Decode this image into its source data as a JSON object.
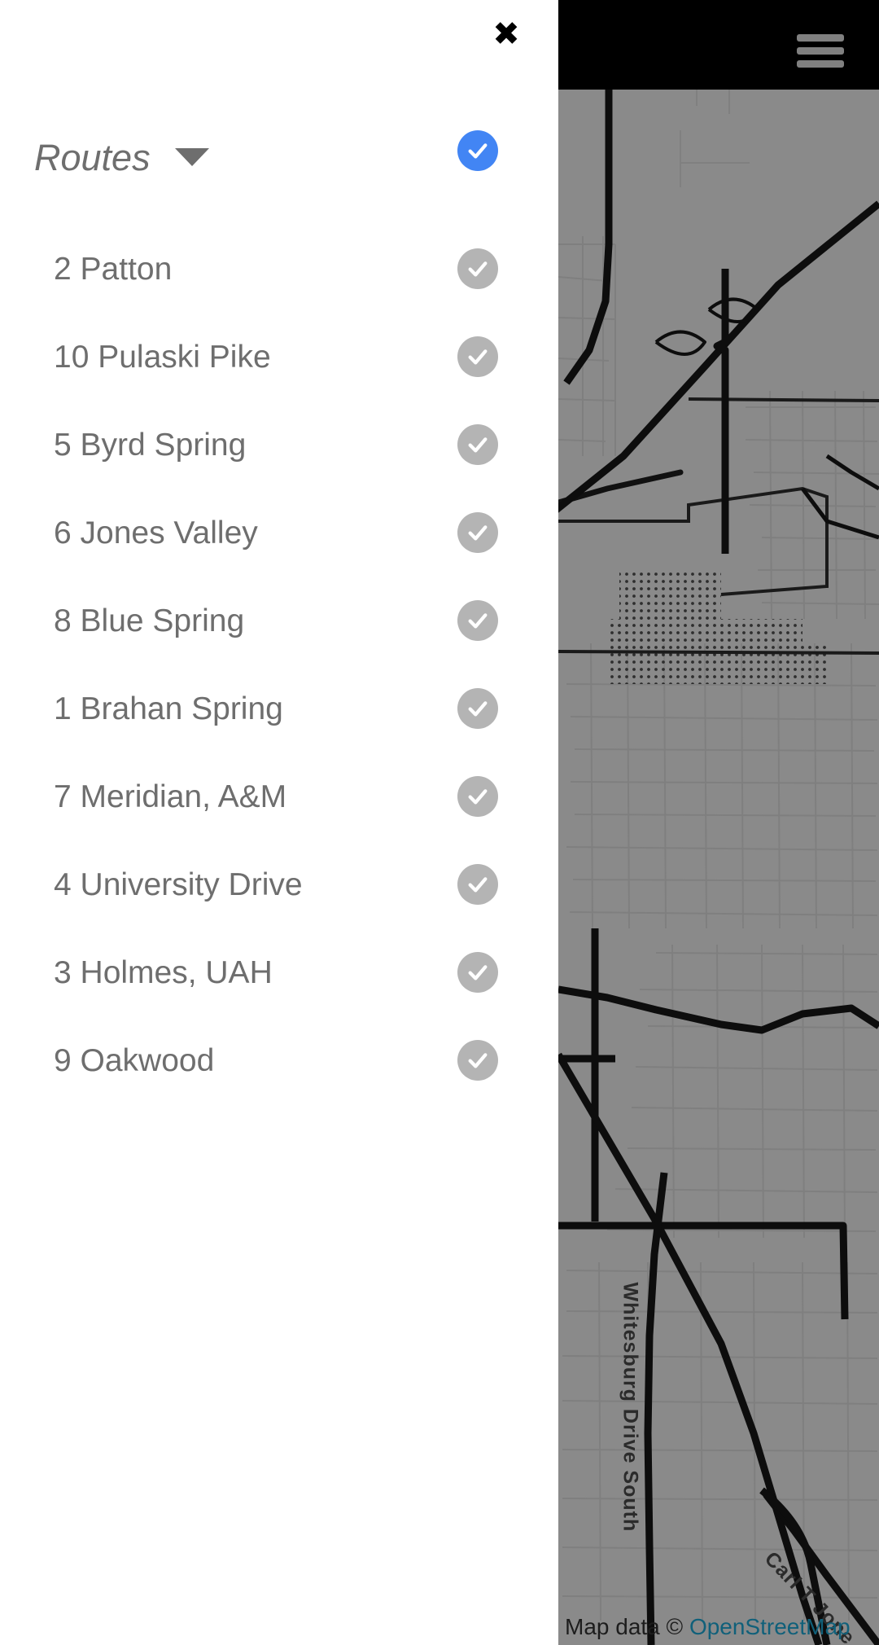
{
  "app": {
    "background_color": "#ffffff",
    "map_background_color": "#8a8a8a",
    "accent_color": "#4285f4",
    "inactive_color": "#b4b4b4",
    "text_color": "#6e6e6e"
  },
  "top_bar": {
    "background_color": "#000000",
    "menu_icon": "hamburger-menu-icon",
    "menu_bar_color": "#808080"
  },
  "panel": {
    "close_icon": "close-icon",
    "close_glyph": "✖",
    "header": {
      "title": "Routes",
      "caret_icon": "chevron-down-icon",
      "master_checked": true,
      "master_check_color": "#4285f4"
    },
    "routes": [
      {
        "label": "2 Patton",
        "checked": true,
        "check_color": "#b4b4b4"
      },
      {
        "label": "10 Pulaski Pike",
        "checked": true,
        "check_color": "#b4b4b4"
      },
      {
        "label": "5 Byrd Spring",
        "checked": true,
        "check_color": "#b4b4b4"
      },
      {
        "label": "6 Jones Valley",
        "checked": true,
        "check_color": "#b4b4b4"
      },
      {
        "label": "8 Blue Spring",
        "checked": true,
        "check_color": "#b4b4b4"
      },
      {
        "label": "1 Brahan Spring",
        "checked": true,
        "check_color": "#b4b4b4"
      },
      {
        "label": "7 Meridian, A&M",
        "checked": true,
        "check_color": "#b4b4b4"
      },
      {
        "label": "4 University Drive",
        "checked": true,
        "check_color": "#b4b4b4"
      },
      {
        "label": "3 Holmes, UAH",
        "checked": true,
        "check_color": "#b4b4b4"
      },
      {
        "label": "9 Oakwood",
        "checked": true,
        "check_color": "#b4b4b4"
      }
    ]
  },
  "map": {
    "labels": [
      {
        "name": "street-label-whitesburg",
        "text": "Whitesburg Drive South"
      },
      {
        "name": "street-label-carl-t-jones",
        "text": "Carl T Jone"
      }
    ],
    "attribution": {
      "prefix": "Map data © ",
      "link_text": "OpenStreetMap",
      "link_color": "#10607a"
    }
  }
}
